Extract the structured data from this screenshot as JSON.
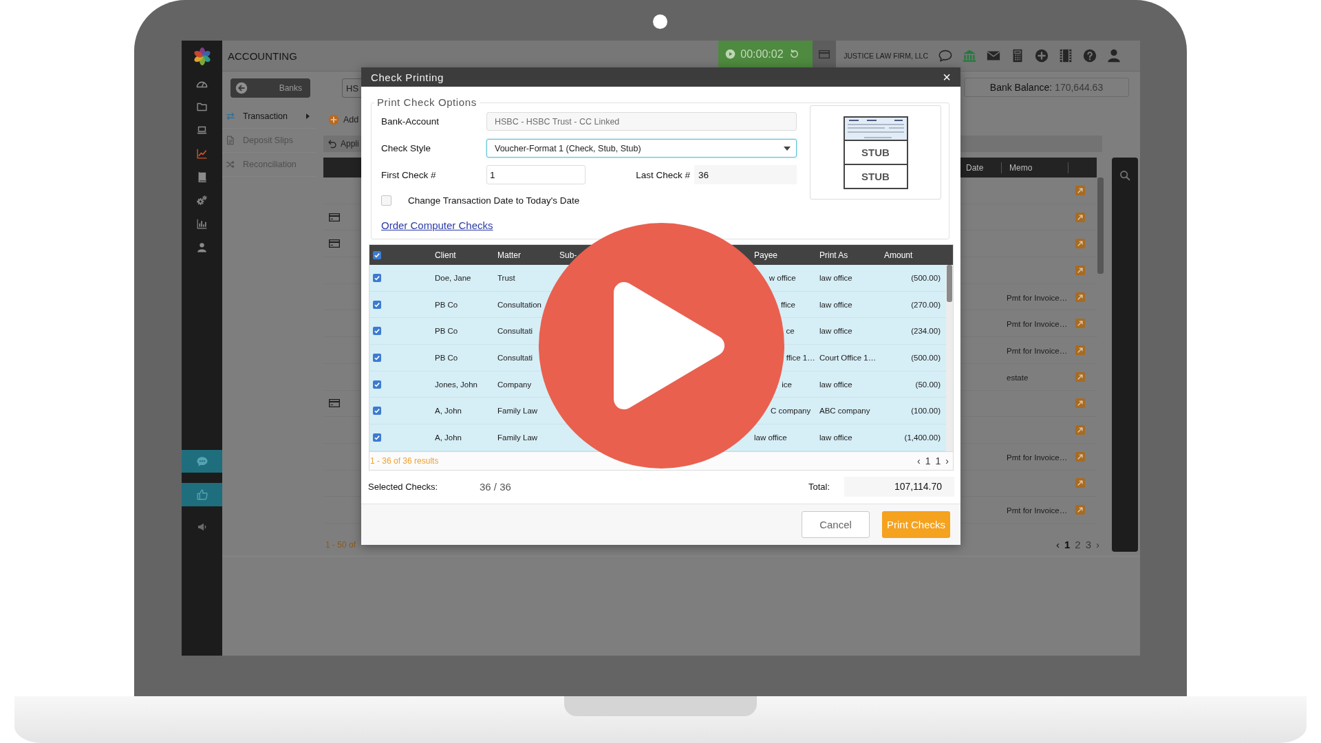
{
  "top_bar": {
    "title": "ACCOUNTING",
    "timer": "00:00:02",
    "firm": "JUSTICE LAW FIRM, LLC"
  },
  "sidebar": {
    "items": [
      {
        "selected": false
      },
      {
        "selected": false
      },
      {
        "selected": false
      },
      {
        "selected": true
      },
      {
        "selected": false
      },
      {
        "selected": false
      },
      {
        "selected": false
      },
      {
        "selected": false
      }
    ]
  },
  "header_row": {
    "back_button": "Banks",
    "account_button": "HS",
    "balance_label": "Bank Balance:",
    "balance_value": "170,644.63"
  },
  "submenu": [
    {
      "label": "Transaction",
      "selected": true
    },
    {
      "label": "Deposit Slips",
      "selected": false
    },
    {
      "label": "Reconciliation",
      "selected": false
    }
  ],
  "toolbar": {
    "add_button": "Add",
    "applied_button": "Appli"
  },
  "register": {
    "columns": [
      "Date",
      "Memo"
    ],
    "rows": [
      {
        "card": false
      },
      {
        "card": true
      },
      {
        "card": true
      },
      {
        "card": false
      },
      {
        "card": false,
        "memo": "Pmt for Invoice…"
      },
      {
        "card": false,
        "memo": "Pmt for Invoice…"
      },
      {
        "card": false,
        "memo": "Pmt for Invoice…"
      },
      {
        "card": false,
        "memo": "estate"
      },
      {
        "card": true
      },
      {
        "card": false
      },
      {
        "card": false,
        "memo": "Pmt for Invoice…"
      },
      {
        "card": false
      },
      {
        "card": false,
        "memo": "Pmt for Invoice…"
      }
    ],
    "results": "1 - 50 of",
    "pager": {
      "prev": "‹",
      "pages": [
        {
          "label": "1",
          "selected": true
        },
        {
          "label": "2",
          "selected": false
        },
        {
          "label": "3",
          "selected": false
        }
      ],
      "next": "›"
    }
  },
  "modal": {
    "title": "Check Printing",
    "close": "×",
    "options": {
      "legend": "Print Check Options",
      "bank_account": {
        "label": "Bank-Account",
        "value": "HSBC - HSBC Trust - CC Linked",
        "disabled": true
      },
      "check_style": {
        "label": "Check Style",
        "value": "Voucher-Format 1 (Check, Stub, Stub)"
      },
      "first_check": {
        "label": "First Check #",
        "value": "1"
      },
      "last_check": {
        "label": "Last Check #",
        "value": "36"
      },
      "change_date": {
        "label": "Change Transaction Date to Today's Date",
        "checked": false
      },
      "order_link": "Order Computer Checks",
      "preview_stubs": [
        "STUB",
        "STUB"
      ]
    },
    "table": {
      "all_checked": true,
      "columns": [
        "Client",
        "Matter",
        "Sub-",
        "Payee",
        "Print As",
        "Amount"
      ],
      "rows": [
        {
          "checked": true,
          "client": "Doe, Jane",
          "matter": "Trust",
          "payee": "w office",
          "print_as": "law office",
          "amount": "(500.00)"
        },
        {
          "checked": true,
          "client": "PB Co",
          "matter": "Consultation",
          "payee": "ffice",
          "print_as": "law office",
          "amount": "(270.00)"
        },
        {
          "checked": true,
          "client": "PB Co",
          "matter": "Consultati",
          "payee": "ce",
          "print_as": "law office",
          "amount": "(234.00)"
        },
        {
          "checked": true,
          "client": "PB Co",
          "matter": "Consultati",
          "payee": "ffice 1…",
          "print_as": "Court Office 1…",
          "amount": "(500.00)"
        },
        {
          "checked": true,
          "client": "Jones, John",
          "matter": "Company",
          "payee": "ice",
          "print_as": "law office",
          "amount": "(50.00)"
        },
        {
          "checked": true,
          "client": "A, John",
          "matter": "Family Law",
          "payee": "C company",
          "print_as": "ABC company",
          "amount": "(100.00)"
        },
        {
          "checked": true,
          "client": "A, John",
          "matter": "Family Law",
          "payee": "law office",
          "print_as": "law office",
          "amount": "(1,400.00)"
        }
      ]
    },
    "results": "1 - 36 of 36 results",
    "pager": {
      "prev": "‹",
      "pages": [
        "1",
        "1"
      ],
      "next": "›"
    },
    "summary": {
      "selected_label": "Selected Checks:",
      "selected_value": "36 / 36",
      "total_label": "Total:",
      "total_value": "107,114.70"
    },
    "buttons": [
      {
        "label": "Cancel",
        "kind": "secondary"
      },
      {
        "label": "Print Checks",
        "kind": "primary"
      }
    ]
  }
}
